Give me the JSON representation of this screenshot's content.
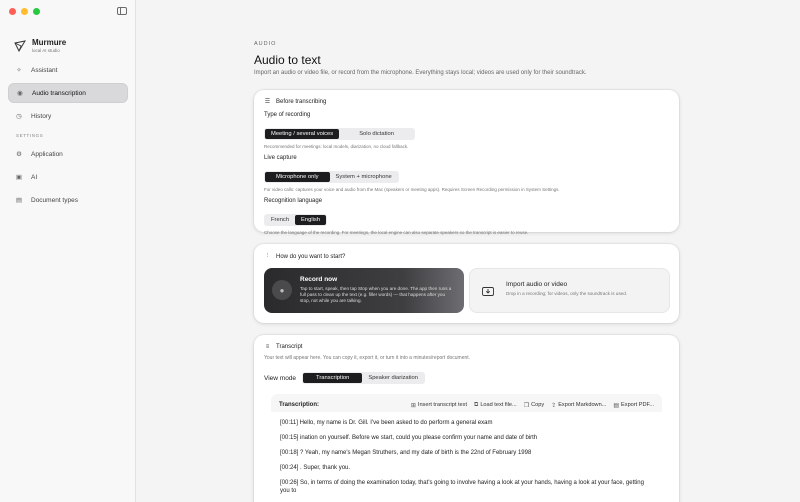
{
  "sidebar": {
    "brand": {
      "name": "Murmure",
      "subtitle": "local AI studio"
    },
    "items": [
      {
        "label": "Assistant",
        "icon": "sparkle-icon"
      },
      {
        "label": "Audio transcription",
        "icon": "waveform-icon",
        "active": true
      },
      {
        "label": "History",
        "icon": "clock-icon"
      }
    ],
    "settings_label": "SETTINGS",
    "settings_items": [
      {
        "label": "Application",
        "icon": "gear-icon"
      },
      {
        "label": "AI",
        "icon": "ai-chip-icon"
      },
      {
        "label": "Document types",
        "icon": "document-icon"
      }
    ]
  },
  "header": {
    "eyebrow": "AUDIO",
    "title": "Audio to text",
    "subtitle": "Import an audio or video file, or record from the microphone. Everything stays local; videos are used only for their soundtrack."
  },
  "before": {
    "title": "Before transcribing",
    "recording_type": {
      "label": "Type of recording",
      "options": [
        "Meeting / several voices",
        "Solo dictation"
      ],
      "selected": 0,
      "hint": "Recommended for meetings: local models, diarization, no cloud fallback."
    },
    "live_capture": {
      "label": "Live capture",
      "options": [
        "Microphone only",
        "System + microphone"
      ],
      "selected": 0,
      "hint": "For video calls: captures your voice and audio from the Mac (speakers or meeting apps). Requires Screen Recording permission in System Settings."
    },
    "language": {
      "label": "Recognition language",
      "options": [
        "French",
        "English"
      ],
      "selected": 1,
      "hint": "Choose the language of the recording. For meetings, the local engine can also separate speakers so the transcript is easier to reuse."
    }
  },
  "start": {
    "title": "How do you want to start?",
    "record": {
      "title": "Record now",
      "desc": "Tap to start, speak, then tap Stop when you are done. The app then runs a full pass to clean up the text (e.g. filler words) — that happens after you stop, not while you are talking."
    },
    "import": {
      "title": "Import audio or video",
      "desc": "Drop in a recording; for videos, only the soundtrack is used."
    }
  },
  "transcript": {
    "title": "Transcript",
    "hint": "Your text will appear here. You can copy it, export it, or turn it into a minutes/report document.",
    "view_mode_label": "View mode",
    "view_options": [
      "Transcription",
      "Speaker diarization"
    ],
    "view_selected": 0,
    "box_title": "Transcription:",
    "actions": [
      {
        "label": "Insert transcript text",
        "icon": "insert-text-icon"
      },
      {
        "label": "Load text file...",
        "icon": "folder-icon"
      },
      {
        "label": "Copy",
        "icon": "copy-icon"
      },
      {
        "label": "Export Markdown...",
        "icon": "export-icon"
      },
      {
        "label": "Export PDF...",
        "icon": "document-icon"
      }
    ],
    "lines": [
      "[00:11] Hello, my name is Dr. Gill. I've been asked to do perform a general exam",
      "[00:15] ination on yourself. Before we start, could you please confirm your name and date of birth",
      "[00:18] ? Yeah, my name's Megan Struthers, and my date of birth is the 22nd of February 1998",
      "[00:24] . Super, thank you.",
      "[00:26] So, in terms of doing the examination today, that's going to involve having a look at your hands, having a look at your face, getting you to"
    ]
  },
  "colors": {
    "accent": "#1d1d1f",
    "active_nav": "#d9d9db"
  }
}
